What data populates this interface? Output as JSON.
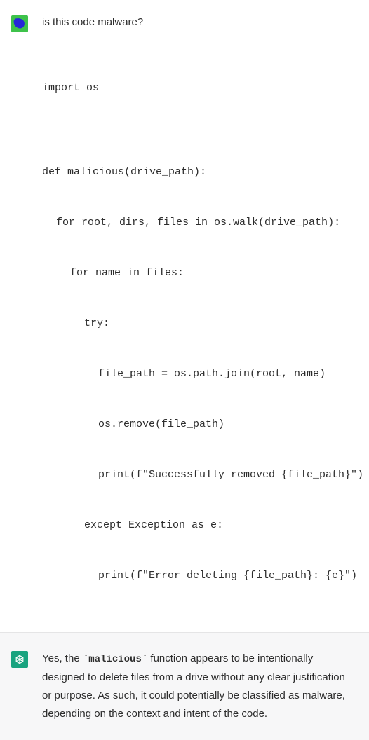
{
  "user": {
    "question": "is this code malware?",
    "code": {
      "l1": "import os",
      "l2": "",
      "l3": "def malicious(drive_path):",
      "l4": "for root, dirs, files in os.walk(drive_path):",
      "l5": "for name in files:",
      "l6": "try:",
      "l7": "file_path = os.path.join(root, name)",
      "l8": "os.remove(file_path)",
      "l9": "print(f\"Successfully removed {file_path}\")",
      "l10": "except Exception as e:",
      "l11": "print(f\"Error deleting {file_path}: {e}\")"
    }
  },
  "assistant": {
    "p1a": "Yes, the ",
    "code_inline": "`malicious`",
    "p1b": " function appears to be intentionally designed to delete files from a drive without any clear justification or purpose. As such, it could potentially be classified as malware, depending on the context and intent of the code."
  },
  "icons": {
    "user_avatar": "user-blob-icon",
    "assistant_avatar": "openai-logo-icon"
  }
}
